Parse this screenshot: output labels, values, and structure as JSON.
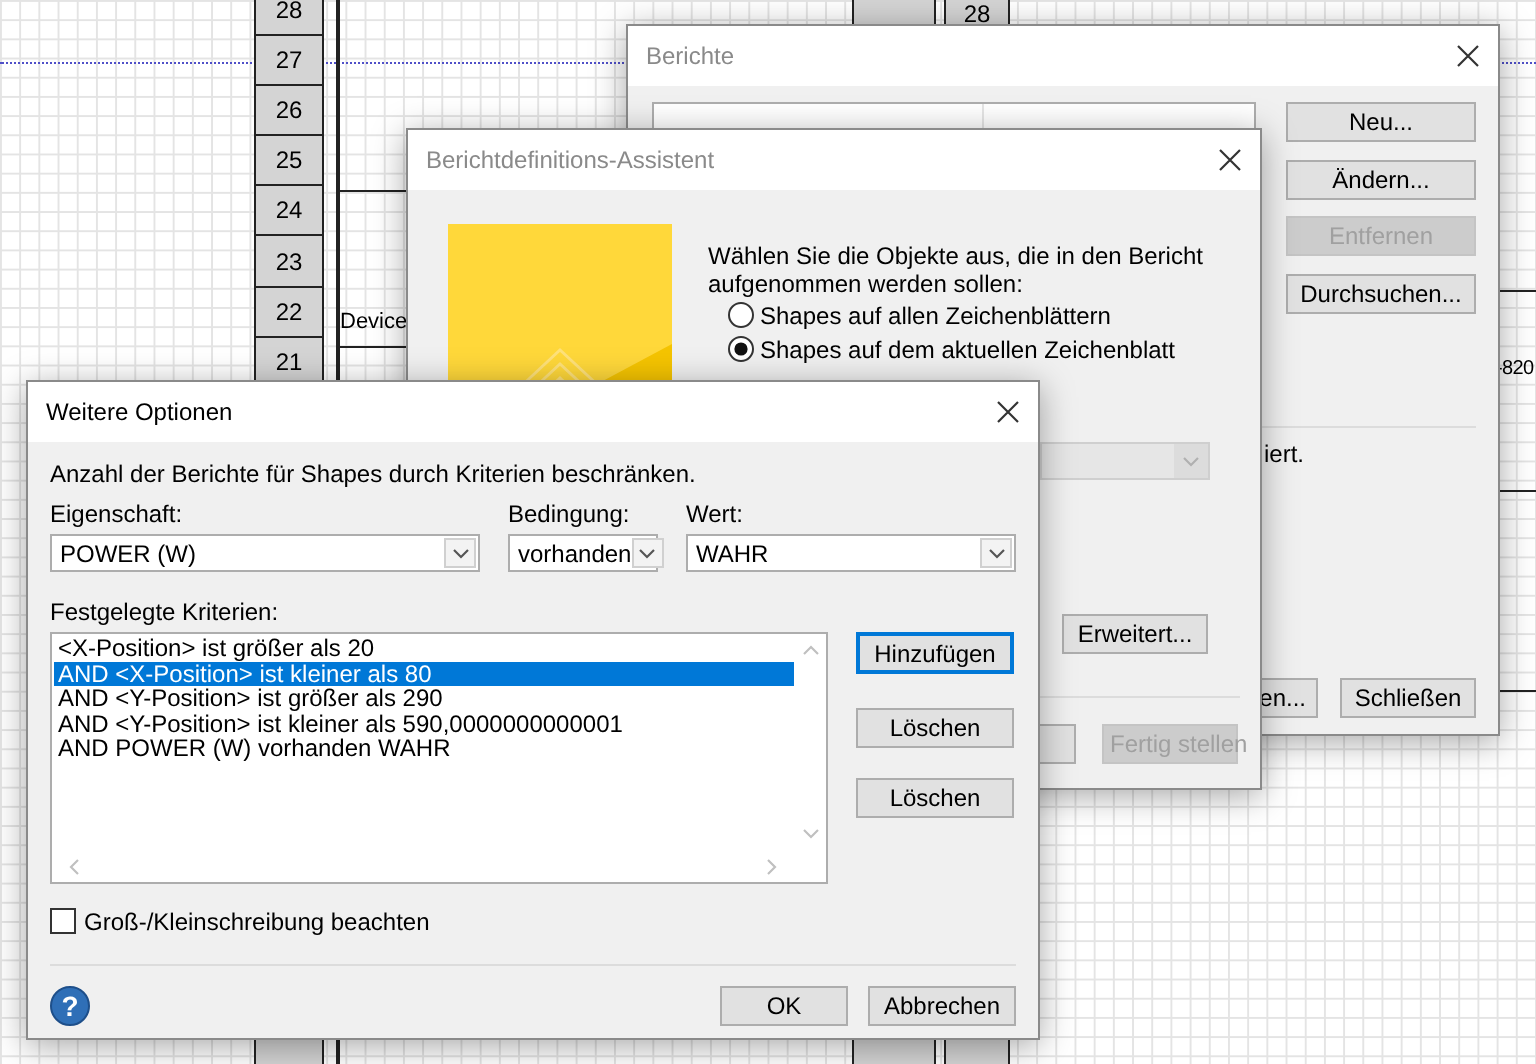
{
  "drawing": {
    "row_numbers": [
      "28",
      "27",
      "26",
      "25",
      "24",
      "23",
      "22",
      "21"
    ],
    "right_cells": [
      "",
      "28"
    ],
    "labels": [
      "Device",
      "-820"
    ]
  },
  "berichte": {
    "title": "Berichte",
    "active": false,
    "buttons": [
      {
        "label": "Neu...",
        "disabled": false
      },
      {
        "label": "Ändern...",
        "disabled": false
      },
      {
        "label": "Entfernen",
        "disabled": true
      },
      {
        "label": "Durchsuchen...",
        "disabled": false
      }
    ],
    "note": "iert.",
    "footer_buttons": [
      {
        "label": "en...",
        "disabled": false
      },
      {
        "label": "Schließen",
        "disabled": false
      }
    ]
  },
  "assistent": {
    "title": "Berichtdefinitions-Assistent",
    "active": false,
    "prompt": "Wählen Sie die Objekte aus, die in den Bericht aufgenommen werden sollen:",
    "scope_options": [
      {
        "label": "Shapes auf allen Zeichenblättern",
        "selected": false
      },
      {
        "label": "Shapes auf dem aktuellen Zeichenblatt",
        "selected": true
      }
    ],
    "layer_dropdown": {
      "disabled": true
    },
    "advanced_button": {
      "label": "Erweitert...",
      "disabled": false
    },
    "footer_buttons": [
      {
        "disabled": false
      },
      {
        "label": "Fertig stellen",
        "disabled": true
      }
    ]
  },
  "weitere_optionen": {
    "title": "Weitere Optionen",
    "active": true,
    "description": "Anzahl der Berichte für Shapes durch Kriterien beschränken.",
    "filters": [
      {
        "label": "Eigenschaft:",
        "value": "POWER (W)"
      },
      {
        "label": "Bedingung:",
        "value": "vorhanden"
      },
      {
        "label": "Wert:",
        "value": "WAHR"
      }
    ],
    "criteria_label": "Festgelegte Kriterien:",
    "criteria": [
      {
        "text": "<X-Position> ist größer als 20",
        "selected": false
      },
      {
        "text": "AND <X-Position> ist kleiner als 80",
        "selected": true
      },
      {
        "text": "AND <Y-Position> ist größer als 290",
        "selected": false
      },
      {
        "text": "AND <Y-Position> ist kleiner als 590,0000000000001",
        "selected": false
      },
      {
        "text": "AND POWER (W) vorhanden WAHR",
        "selected": false
      }
    ],
    "side_buttons": [
      {
        "label": "Hinzufügen",
        "focused": true
      },
      {
        "label": "Löschen",
        "focused": false
      },
      {
        "label": "Löschen",
        "focused": false
      }
    ],
    "case_checkbox": {
      "label": "Groß-/Kleinschreibung beachten",
      "checked": false
    },
    "help_button": "?",
    "footer_buttons": [
      {
        "label": "OK",
        "focused": false
      },
      {
        "label": "Abbrechen",
        "focused": false
      }
    ]
  }
}
